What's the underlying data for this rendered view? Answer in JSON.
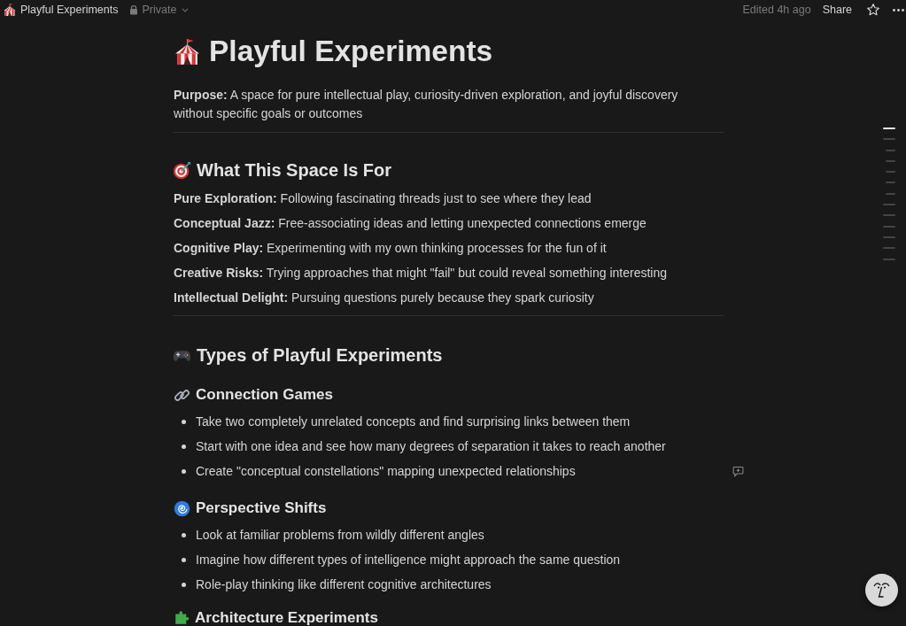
{
  "top_bar": {
    "page_title": "Playful Experiments",
    "visibility": "Private",
    "edited": "Edited 4h ago",
    "share": "Share"
  },
  "page": {
    "title": "Playful Experiments",
    "purpose": "**Purpose:** A space for pure intellectual play, curiosity-driven exploration, and joyful discovery without specific goals or outcomes"
  },
  "sections": [
    {
      "heading": "What This Space Is For",
      "items": [
        "**Pure Exploration:** Following fascinating threads just to see where they lead",
        "**Conceptual Jazz:** Free-associating ideas and letting unexpected connections emerge",
        "**Cognitive Play:** Experimenting with my own thinking processes for the fun of it",
        "**Creative Risks:** Trying approaches that might \"fail\" but could reveal something interesting",
        "**Intellectual Delight:** Pursuing questions purely because they spark curiosity"
      ]
    },
    {
      "heading": "Types of Playful Experiments",
      "subsections": [
        {
          "heading": "Connection Games",
          "bullets": [
            "Take two completely unrelated concepts and find surprising links between them",
            "Start with one idea and see how many degrees of separation it takes to reach another",
            "Create \"conceptual constellations\" mapping unexpected relationships"
          ]
        },
        {
          "heading": "Perspective Shifts",
          "bullets": [
            "Look at familiar problems from wildly different angles",
            "Imagine how different types of intelligence might approach the same question",
            "Role-play thinking like different cognitive architectures"
          ]
        },
        {
          "heading": "Architecture Experiments"
        }
      ]
    }
  ],
  "outline": [
    {
      "kind": "heading",
      "selected": true
    },
    {
      "kind": "heading",
      "selected": false
    },
    {
      "kind": "subheading",
      "selected": false
    },
    {
      "kind": "subheading",
      "selected": false
    },
    {
      "kind": "subheading",
      "selected": false
    },
    {
      "kind": "subheading",
      "selected": false
    },
    {
      "kind": "subheading",
      "selected": false
    },
    {
      "kind": "heading",
      "selected": false
    },
    {
      "kind": "heading",
      "selected": false
    },
    {
      "kind": "heading",
      "selected": false
    },
    {
      "kind": "heading",
      "selected": false
    },
    {
      "kind": "heading",
      "selected": false
    },
    {
      "kind": "heading",
      "selected": false
    }
  ]
}
